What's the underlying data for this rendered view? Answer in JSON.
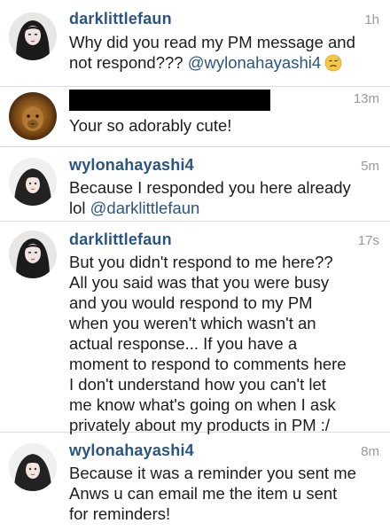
{
  "comments": [
    {
      "username": "darklittlefaun",
      "time": "1h",
      "lines": [
        "Why did you read my PM message and",
        "not respond??? "
      ],
      "mention": "@wylonahayashi4",
      "emoji": "sad-sweat-face-emoji"
    },
    {
      "username": "",
      "username_redacted": true,
      "time": "13m",
      "lines": [
        "Your so adorably cute!"
      ]
    },
    {
      "username": "wylonahayashi4",
      "time": "5m",
      "lines": [
        "Because I responded you here already",
        "lol "
      ],
      "mention": "@darklittlefaun"
    },
    {
      "username": "darklittlefaun",
      "time": "17s",
      "lines": [
        "But you didn't respond to me here??",
        "All you said was that you were busy",
        "and you would respond to my PM",
        "when you weren't which wasn't an",
        "actual response... If you have a",
        "moment to respond to comments here",
        "I don't understand how you can't let",
        "me know what's going on when I ask",
        "privately about my products in PM :/"
      ]
    },
    {
      "username": "wylonahayashi4",
      "time": "8m",
      "lines": [
        "Because it was a reminder you sent me",
        "Anws u can email me the item u sent",
        "for reminders!"
      ]
    }
  ],
  "colors": {
    "username": "#2a5580",
    "mention": "#2a5580",
    "timestamp": "#9a9a9a",
    "text": "#1c1c1c",
    "divider": "#dcdcdc"
  }
}
